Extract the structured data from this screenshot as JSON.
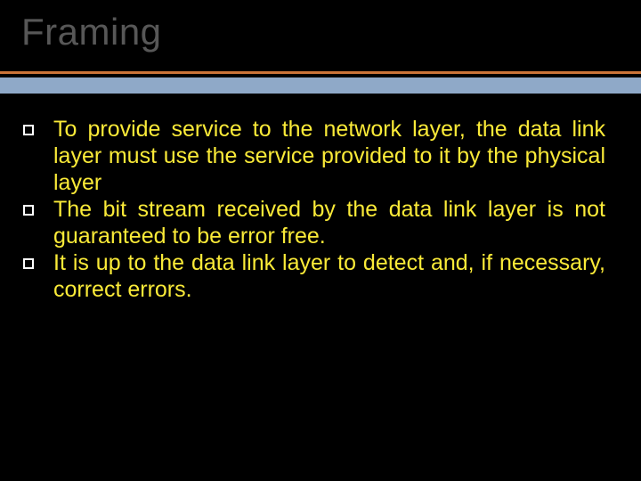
{
  "title": "Framing",
  "bullets": [
    "To provide service to the network layer, the data link layer must use the service provided to it by the physical layer",
    "The bit stream received by the data link layer is not guaranteed to be error free.",
    "It is up to the data link layer to detect and, if necessary, correct errors."
  ]
}
